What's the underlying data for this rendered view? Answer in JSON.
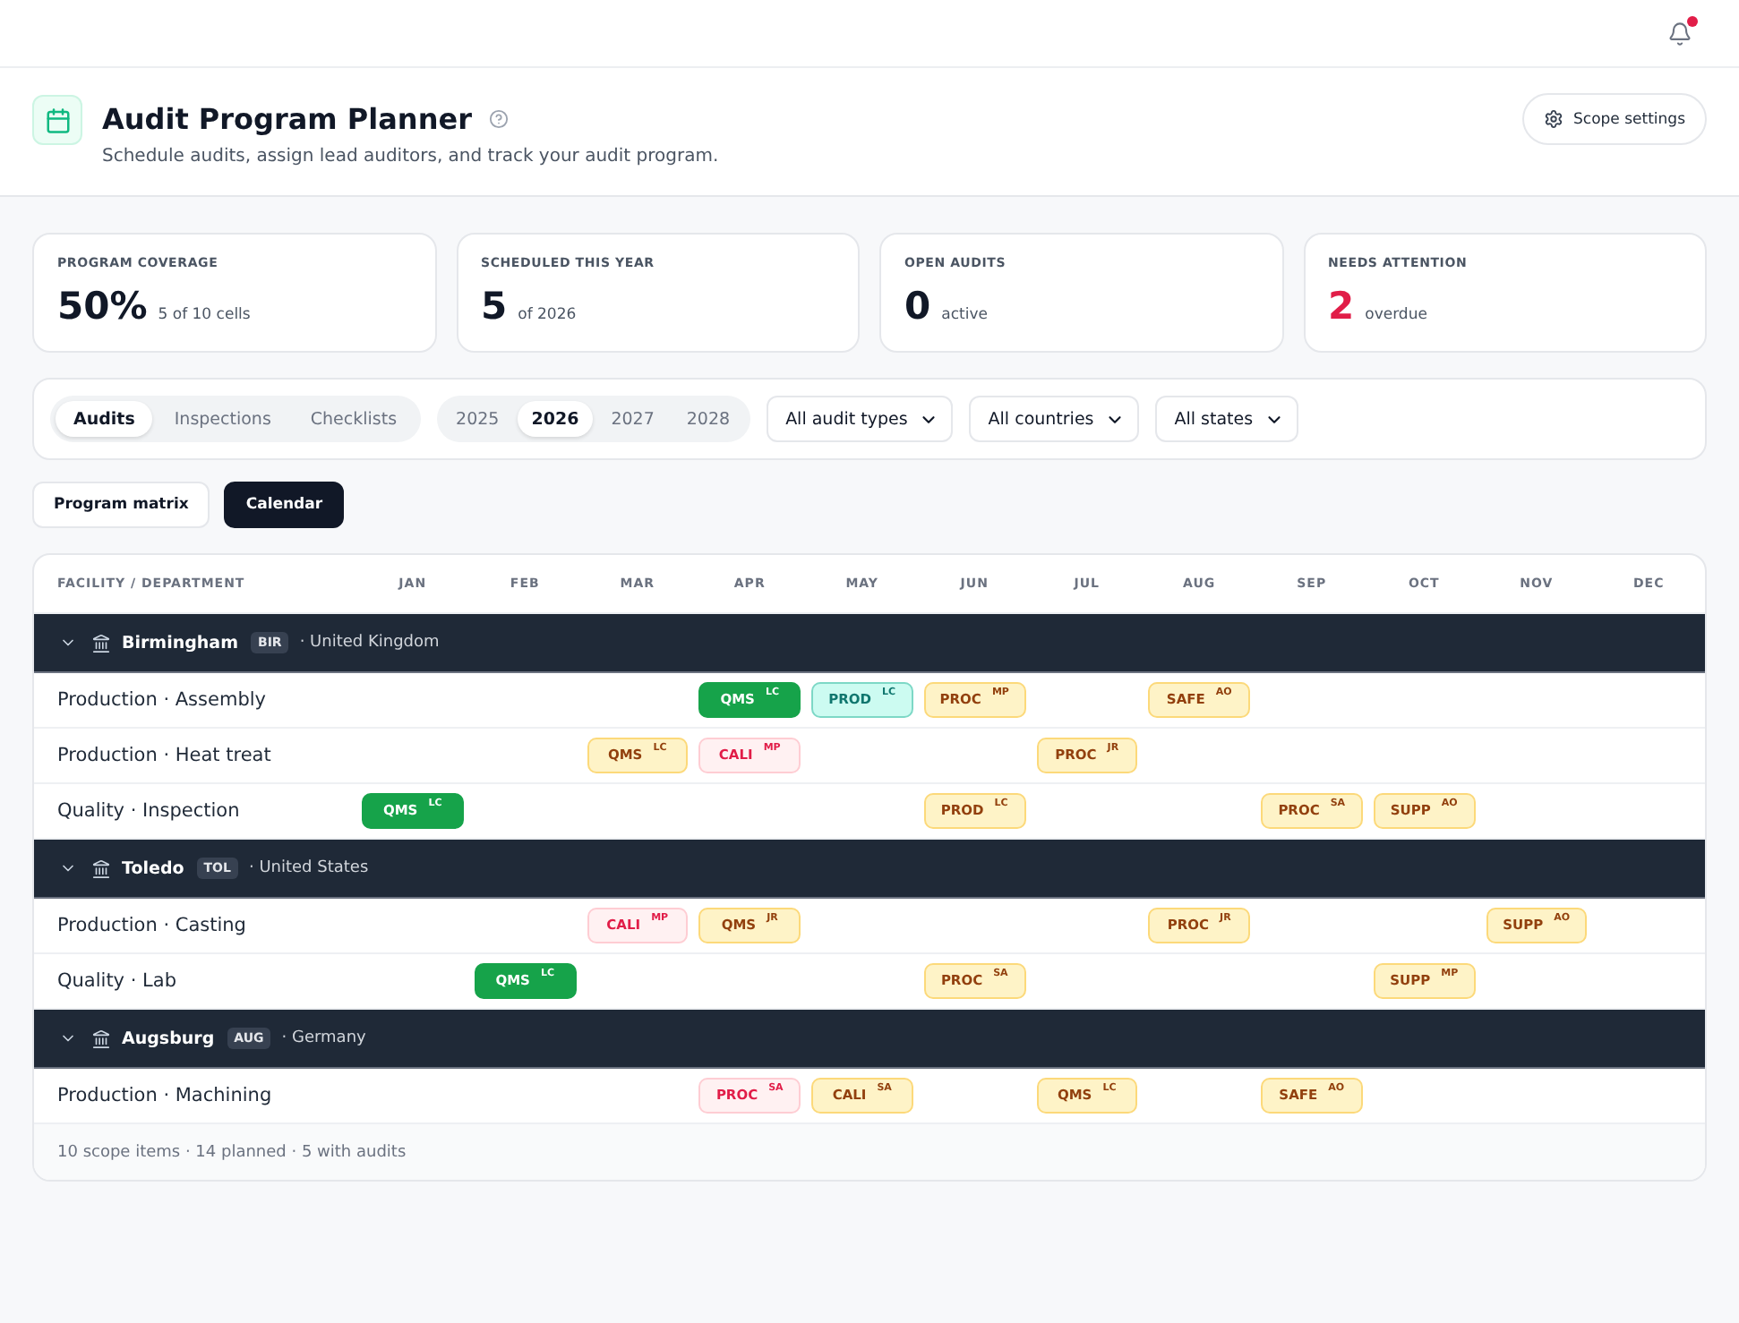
{
  "top_bar": {
    "notifications": {
      "unread": true
    }
  },
  "header": {
    "title": "Audit Program Planner",
    "subtitle": "Schedule audits, assign lead auditors, and track your audit program.",
    "button": "Scope settings"
  },
  "stats": [
    {
      "label": "PROGRAM COVERAGE",
      "value": "50%",
      "note": "5 of 10 cells",
      "alert": false
    },
    {
      "label": "SCHEDULED THIS YEAR",
      "value": "5",
      "note": "of 2026",
      "alert": false
    },
    {
      "label": "OPEN AUDITS",
      "value": "0",
      "note": "active",
      "alert": false
    },
    {
      "label": "NEEDS ATTENTION",
      "value": "2",
      "note": "overdue",
      "alert": true
    }
  ],
  "filters": {
    "tabs": [
      {
        "label": "Audits",
        "selected": true
      },
      {
        "label": "Inspections",
        "selected": false
      },
      {
        "label": "Checklists",
        "selected": false
      }
    ],
    "years": [
      {
        "label": "2025",
        "selected": false
      },
      {
        "label": "2026",
        "selected": true
      },
      {
        "label": "2027",
        "selected": false
      },
      {
        "label": "2028",
        "selected": false
      }
    ],
    "dropdowns": [
      "All audit types",
      "All countries",
      "All states"
    ]
  },
  "views": [
    {
      "label": "Program matrix",
      "selected": false
    },
    {
      "label": "Calendar",
      "selected": true
    }
  ],
  "calendar": {
    "first_column": "FACILITY / DEPARTMENT",
    "months": [
      "JAN",
      "FEB",
      "MAR",
      "APR",
      "MAY",
      "JUN",
      "JUL",
      "AUG",
      "SEP",
      "OCT",
      "NOV",
      "DEC"
    ],
    "groups": [
      {
        "name": "Birmingham",
        "code": "BIR",
        "country": "· United Kingdom",
        "expanded": true,
        "rows": [
          {
            "name": "Production · Assembly",
            "cells": [
              {
                "kind": "empty"
              },
              {
                "kind": "empty"
              },
              {
                "kind": "empty"
              },
              {
                "kind": "complete",
                "label": "QMS",
                "auditor": "LC"
              },
              {
                "kind": "confirmed",
                "label": "PROD",
                "auditor": "LC"
              },
              {
                "kind": "planned",
                "label": "PROC",
                "auditor": "MP"
              },
              {
                "kind": "empty"
              },
              {
                "kind": "planned",
                "label": "SAFE",
                "auditor": "AO"
              },
              {
                "kind": "empty"
              },
              {
                "kind": "empty"
              },
              {
                "kind": "empty"
              },
              {
                "kind": "empty"
              }
            ]
          },
          {
            "name": "Production · Heat treat",
            "cells": [
              {
                "kind": "empty"
              },
              {
                "kind": "empty"
              },
              {
                "kind": "planned",
                "label": "QMS",
                "auditor": "LC"
              },
              {
                "kind": "overdue",
                "label": "CALI",
                "auditor": "MP"
              },
              {
                "kind": "empty"
              },
              {
                "kind": "empty"
              },
              {
                "kind": "planned",
                "label": "PROC",
                "auditor": "JR"
              },
              {
                "kind": "empty"
              },
              {
                "kind": "empty"
              },
              {
                "kind": "empty"
              },
              {
                "kind": "empty"
              },
              {
                "kind": "empty"
              }
            ]
          },
          {
            "name": "Quality · Inspection",
            "cells": [
              {
                "kind": "complete",
                "label": "QMS",
                "auditor": "LC"
              },
              {
                "kind": "empty"
              },
              {
                "kind": "empty"
              },
              {
                "kind": "empty"
              },
              {
                "kind": "empty"
              },
              {
                "kind": "planned",
                "label": "PROD",
                "auditor": "LC"
              },
              {
                "kind": "empty"
              },
              {
                "kind": "empty"
              },
              {
                "kind": "planned",
                "label": "PROC",
                "auditor": "SA"
              },
              {
                "kind": "planned",
                "label": "SUPP",
                "auditor": "AO"
              },
              {
                "kind": "empty"
              },
              {
                "kind": "empty"
              }
            ]
          }
        ]
      },
      {
        "name": "Toledo",
        "code": "TOL",
        "country": "· United States",
        "expanded": true,
        "rows": [
          {
            "name": "Production · Casting",
            "cells": [
              {
                "kind": "empty"
              },
              {
                "kind": "empty"
              },
              {
                "kind": "overdue",
                "label": "CALI",
                "auditor": "MP"
              },
              {
                "kind": "planned",
                "label": "QMS",
                "auditor": "JR"
              },
              {
                "kind": "empty"
              },
              {
                "kind": "empty"
              },
              {
                "kind": "empty"
              },
              {
                "kind": "planned",
                "label": "PROC",
                "auditor": "JR"
              },
              {
                "kind": "empty"
              },
              {
                "kind": "empty"
              },
              {
                "kind": "planned",
                "label": "SUPP",
                "auditor": "AO"
              },
              {
                "kind": "empty"
              }
            ]
          },
          {
            "name": "Quality · Lab",
            "cells": [
              {
                "kind": "empty"
              },
              {
                "kind": "complete",
                "label": "QMS",
                "auditor": "LC"
              },
              {
                "kind": "empty"
              },
              {
                "kind": "empty"
              },
              {
                "kind": "empty"
              },
              {
                "kind": "planned",
                "label": "PROC",
                "auditor": "SA"
              },
              {
                "kind": "empty"
              },
              {
                "kind": "empty"
              },
              {
                "kind": "empty"
              },
              {
                "kind": "planned",
                "label": "SUPP",
                "auditor": "MP"
              },
              {
                "kind": "empty"
              },
              {
                "kind": "empty"
              }
            ]
          }
        ]
      },
      {
        "name": "Augsburg",
        "code": "AUG",
        "country": "· Germany",
        "expanded": true,
        "rows": [
          {
            "name": "Production · Machining",
            "cells": [
              {
                "kind": "empty"
              },
              {
                "kind": "empty"
              },
              {
                "kind": "empty"
              },
              {
                "kind": "overdue",
                "label": "PROC",
                "auditor": "SA"
              },
              {
                "kind": "planned",
                "label": "CALI",
                "auditor": "SA"
              },
              {
                "kind": "empty"
              },
              {
                "kind": "planned",
                "label": "QMS",
                "auditor": "LC"
              },
              {
                "kind": "empty"
              },
              {
                "kind": "planned",
                "label": "SAFE",
                "auditor": "AO"
              },
              {
                "kind": "empty"
              },
              {
                "kind": "empty"
              },
              {
                "kind": "empty"
              }
            ]
          }
        ]
      }
    ],
    "footer": "10 scope items · 14 planned · 5 with audits"
  }
}
